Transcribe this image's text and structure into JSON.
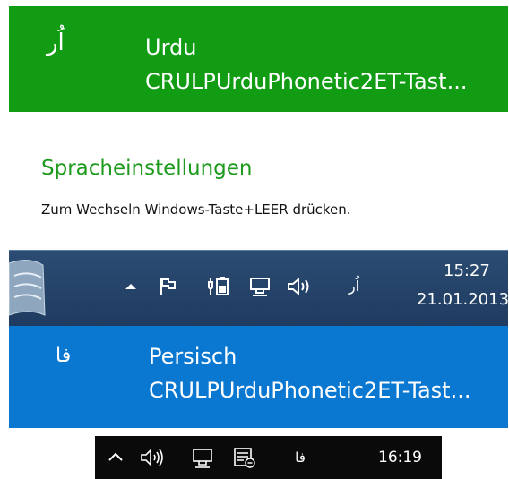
{
  "urdu_item": {
    "glyph": "اُر",
    "language": "Urdu",
    "layout": "CRULPUrduPhonetic2ET-Tast..."
  },
  "settings": {
    "link": "Spracheinstellungen",
    "hint": "Zum Wechseln Windows-Taste+LEER drücken."
  },
  "taskbar_win8": {
    "input_indicator": "اُر",
    "time": "15:27",
    "date": "21.01.2013"
  },
  "persian_item": {
    "glyph": "فا",
    "language": "Persisch",
    "layout": "CRULPUrduPhonetic2ET-Tast..."
  },
  "taskbar_win10": {
    "input_indicator": "فا",
    "time": "16:19"
  },
  "colors": {
    "green_item_bg": "#119c14",
    "settings_link": "#1e9b1e",
    "win8_taskbar_bg": "#1f3b60",
    "blue_item_bg": "#0a77d1",
    "win10_taskbar_bg": "#0a0a0a"
  },
  "icons": {
    "win8_tray": [
      "chevron-up-icon",
      "action-center-flag-icon",
      "power-battery-icon",
      "network-icon",
      "speaker-icon"
    ],
    "win10_tray": [
      "chevron-up-icon",
      "speaker-icon",
      "network-icon",
      "notifications-icon"
    ]
  }
}
